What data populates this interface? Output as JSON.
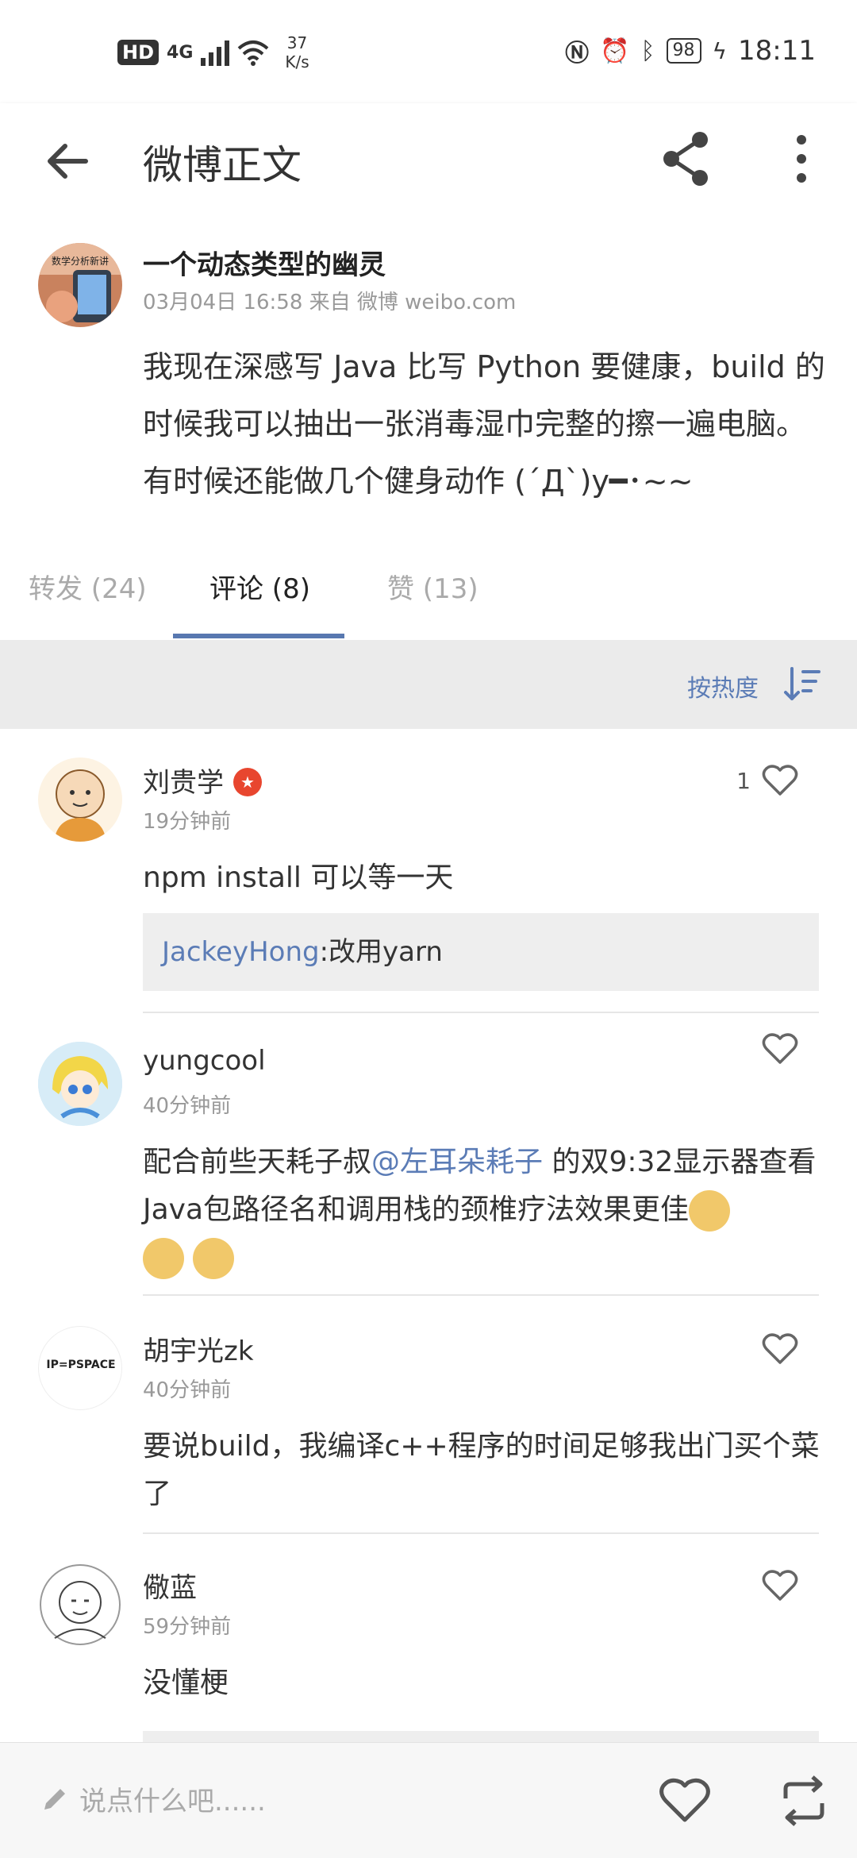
{
  "status_bar": {
    "hd": "HD",
    "network": "4G",
    "speed_value": "37",
    "speed_unit": "K/s",
    "battery": "98",
    "time": "18:11"
  },
  "app_bar": {
    "title": "微博正文"
  },
  "post": {
    "author": "一个动态类型的幽灵",
    "meta": "03月04日 16:58  来自 微博 weibo.com",
    "avatar_caption": "数学分析新讲",
    "text": "我现在深感写 Java 比写 Python 要健康，build 的时候我可以抽出一张消毒湿巾完整的擦一遍电脑。有时候还能做几个健身动作 (´Д`)y━･~~"
  },
  "tabs": [
    {
      "label": "转发 (24)"
    },
    {
      "label": "评论 (8)"
    },
    {
      "label": "赞 (13)"
    }
  ],
  "sort": {
    "label": "按热度"
  },
  "comments": [
    {
      "name": "刘贵学",
      "time": "19分钟前",
      "likes": "1",
      "text": "npm install 可以等一天",
      "reply_user": "JackeyHong",
      "reply_text": ":改用yarn"
    },
    {
      "name": "yungcool",
      "time": "40分钟前",
      "likes": "",
      "text_before": "配合前些天耗子叔",
      "mention": "@左耳朵耗子",
      "text_after": " 的双9:32显示器查看Java包路径名和调用栈的颈椎疗法效果更佳"
    },
    {
      "name": "胡宇光zk",
      "time": "40分钟前",
      "likes": "",
      "avatar_text": "IP=PSPACE",
      "text": "要说build，我编译c++程序的时间足够我出门买个菜了"
    },
    {
      "name": "儆蓝",
      "time": "59分钟前",
      "likes": "",
      "text": "没懂梗"
    }
  ],
  "bottom_bar": {
    "placeholder": "说点什么吧......"
  },
  "colors": {
    "accent": "#5878b0",
    "link": "#5b7cb6",
    "verified": "#e8462f"
  }
}
